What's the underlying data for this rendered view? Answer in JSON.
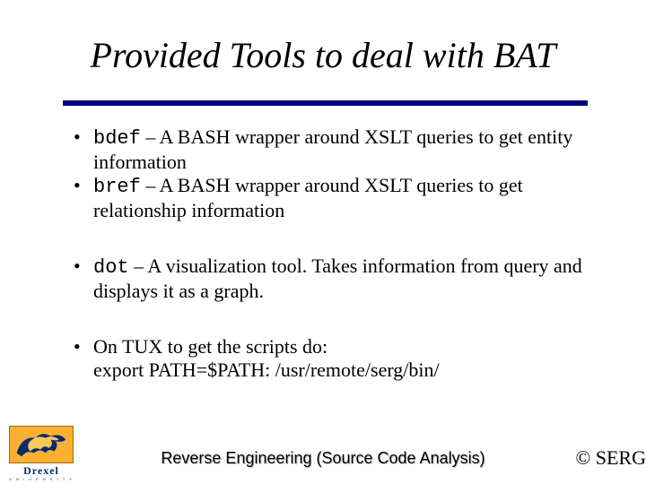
{
  "title": "Provided Tools to deal with BAT",
  "bullets": [
    {
      "code": "bdef",
      "text": " – A BASH wrapper around XSLT queries to get entity information"
    },
    {
      "code": "bref",
      "text": " – A BASH wrapper around XSLT queries to get relationship information"
    },
    {
      "code": "dot",
      "text": " – A visualization tool.  Takes information from query and displays it as a graph."
    }
  ],
  "tux_line1": "On TUX to get the scripts do:",
  "tux_line2": "export PATH=$PATH: /usr/remote/serg/bin/",
  "logo": {
    "word": "Drexel",
    "sub": "U N I V E R S I T Y"
  },
  "footer_center": "Reverse Engineering (Source Code Analysis)",
  "footer_right": "© SERG"
}
